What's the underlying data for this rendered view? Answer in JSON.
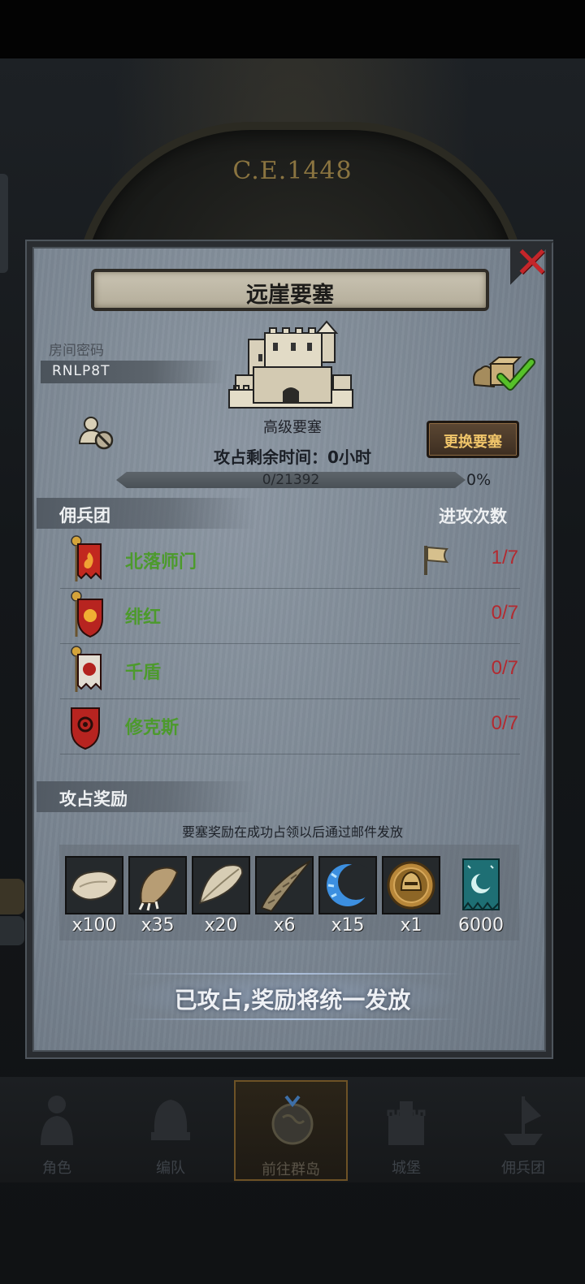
{
  "era_label": "C.E.1448",
  "panel": {
    "title": "远崖要塞",
    "room_label": "房间密码",
    "room_code": "RNLP8T",
    "fortress_type": "高级要塞",
    "time_label": "攻占剩余时间：",
    "time_value": "0小时",
    "change_button": "更换要塞",
    "progress_text": "0/21392",
    "progress_percent": "0%",
    "progress_fraction": 0
  },
  "mercenary_section": {
    "title": "佣兵团",
    "attack_header": "进攻次数",
    "rows": [
      {
        "name": "北落师门",
        "count": "1/7",
        "flag": true
      },
      {
        "name": "绯红",
        "count": "0/7",
        "flag": false
      },
      {
        "name": "千盾",
        "count": "0/7",
        "flag": false
      },
      {
        "name": "修克斯",
        "count": "0/7",
        "flag": false
      }
    ]
  },
  "reward_section": {
    "title": "攻占奖励",
    "note": "要塞奖励在成功占领以后通过邮件发放",
    "items": [
      {
        "icon": "fur-pelt-icon",
        "qty": "x100"
      },
      {
        "icon": "claw-icon",
        "qty": "x35"
      },
      {
        "icon": "feather-icon",
        "qty": "x20"
      },
      {
        "icon": "horn-icon",
        "qty": "x6"
      },
      {
        "icon": "crescent-moon-icon",
        "qty": "x15"
      },
      {
        "icon": "helmet-coin-icon",
        "qty": "x1"
      },
      {
        "icon": "banner-icon",
        "qty": "6000"
      }
    ]
  },
  "claim_text": "已攻占,奖励将统一发放",
  "bottom_nav": [
    {
      "label": "角色",
      "icon": "knight-icon",
      "active": false
    },
    {
      "label": "编队",
      "icon": "helmet-icon",
      "active": false
    },
    {
      "label": "前往群岛",
      "icon": "globe-icon",
      "active": true
    },
    {
      "label": "城堡",
      "icon": "castle-icon",
      "active": false
    },
    {
      "label": "佣兵团",
      "icon": "ship-icon",
      "active": false
    }
  ]
}
